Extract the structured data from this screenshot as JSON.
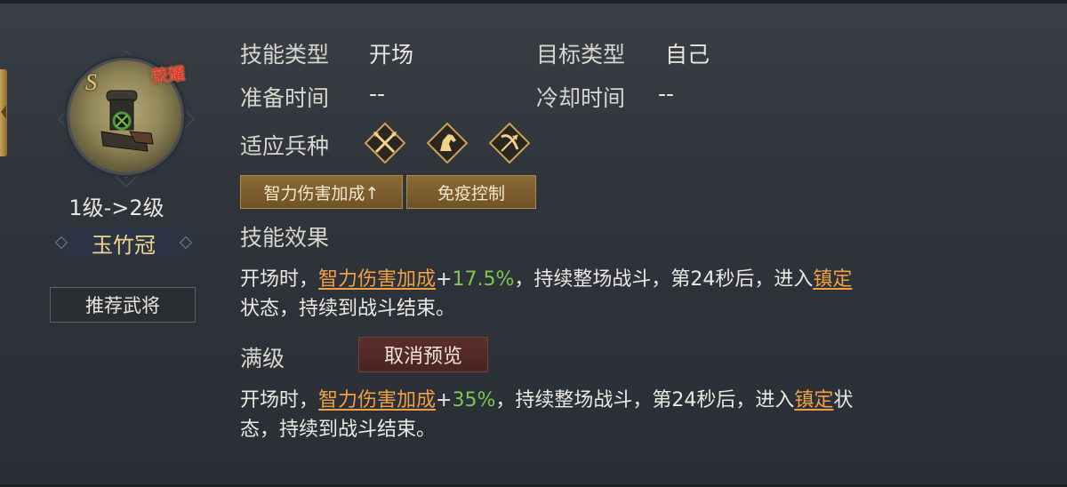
{
  "skill": {
    "grade": "S",
    "badge": "荣耀",
    "level_text": "1级->2级",
    "name": "玉竹冠",
    "recommend_label": "推荐武将",
    "item_icon": "scroll-relic-icon"
  },
  "info": {
    "skill_type_label": "技能类型",
    "skill_type_value": "开场",
    "target_type_label": "目标类型",
    "target_type_value": "自己",
    "prep_time_label": "准备时间",
    "prep_time_value": "--",
    "cooldown_label": "冷却时间",
    "cooldown_value": "--",
    "troop_label": "适应兵种",
    "troop_icons": [
      "crossed-spears-icon",
      "horse-head-icon",
      "bow-arrow-icon"
    ]
  },
  "tags": [
    "智力伤害加成↑",
    "免疫控制"
  ],
  "effect": {
    "title": "技能效果",
    "line1": {
      "prefix": "开场时，",
      "keyword": "智力伤害加成",
      "plus": "+",
      "value": "17.5%",
      "middle": "，持续整场战斗，第24秒后，进入",
      "keyword2": "镇定"
    },
    "line2": "状态，持续到战斗结束。"
  },
  "max_level": {
    "title": "满级",
    "cancel_label": "取消预览",
    "line1": {
      "prefix": "开场时，",
      "keyword": "智力伤害加成",
      "plus": "+",
      "value": "35%",
      "middle": "，持续整场战斗，第24秒后，进入",
      "keyword2": "镇定",
      "suffix": "状"
    },
    "line2": "态，持续到战斗结束。"
  },
  "colors": {
    "keyword": "#f0a042",
    "number": "#7fc653",
    "name_gold": "#f2d38a"
  }
}
